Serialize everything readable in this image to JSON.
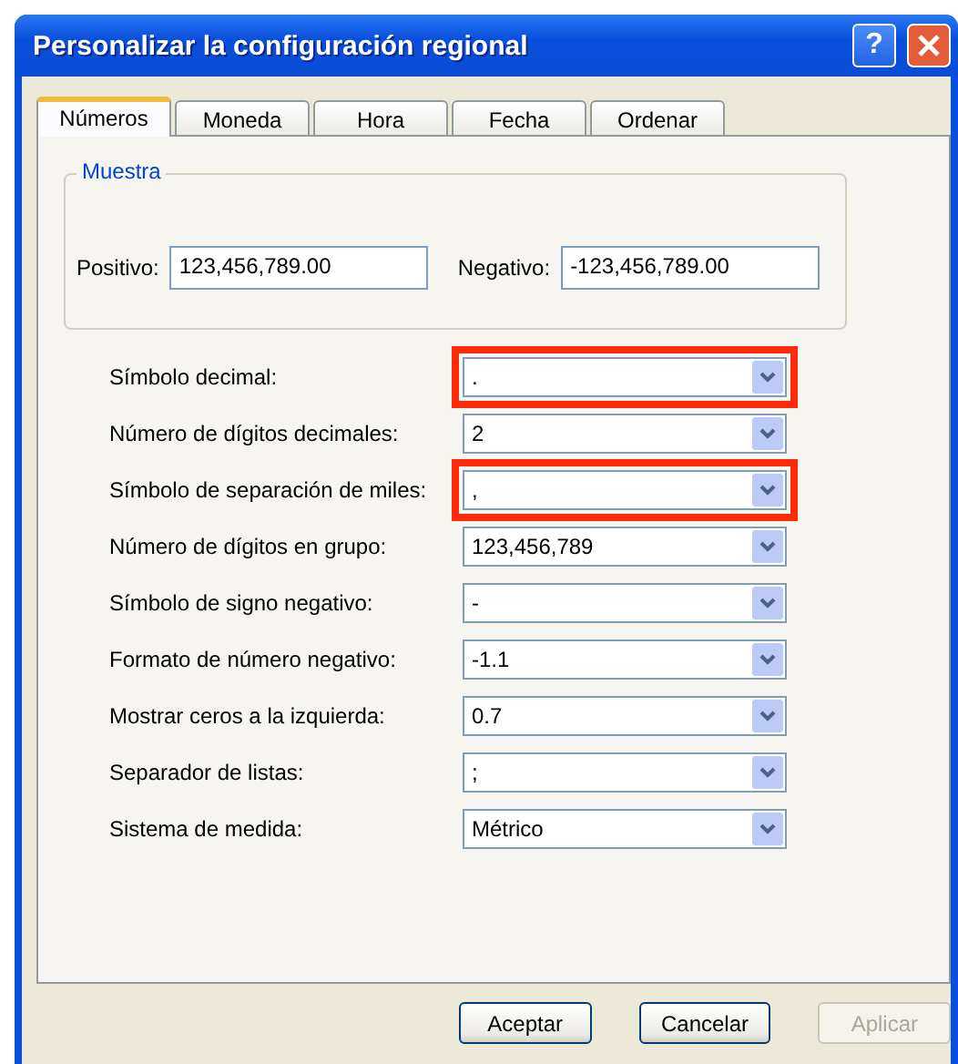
{
  "window": {
    "title": "Personalizar la configuración regional",
    "help_button": "?"
  },
  "tabs": [
    {
      "label": "Números",
      "selected": true
    },
    {
      "label": "Moneda",
      "selected": false
    },
    {
      "label": "Hora",
      "selected": false
    },
    {
      "label": "Fecha",
      "selected": false
    },
    {
      "label": "Ordenar",
      "selected": false
    }
  ],
  "sample": {
    "legend": "Muestra",
    "fields": [
      {
        "label": "Positivo:",
        "value": "123,456,789.00"
      },
      {
        "label": "Negativo:",
        "value": "-123,456,789.00"
      }
    ]
  },
  "settings": [
    {
      "label": "Símbolo decimal:",
      "value": ".",
      "highlighted": true
    },
    {
      "label": "Número de dígitos decimales:",
      "value": "2",
      "highlighted": false
    },
    {
      "label": "Símbolo de separación de miles:",
      "value": ",",
      "highlighted": true
    },
    {
      "label": "Número de dígitos en grupo:",
      "value": "123,456,789",
      "highlighted": false
    },
    {
      "label": "Símbolo de signo negativo:",
      "value": "-",
      "highlighted": false
    },
    {
      "label": "Formato de número negativo:",
      "value": "-1.1",
      "highlighted": false
    },
    {
      "label": "Mostrar ceros a la izquierda:",
      "value": "0.7",
      "highlighted": false
    },
    {
      "label": "Separador de listas:",
      "value": ";",
      "highlighted": false
    },
    {
      "label": "Sistema de medida:",
      "value": "Métrico",
      "highlighted": false
    }
  ],
  "buttons": [
    {
      "label": "Aceptar",
      "disabled": false
    },
    {
      "label": "Cancelar",
      "disabled": false
    },
    {
      "label": "Aplicar",
      "disabled": true
    }
  ]
}
